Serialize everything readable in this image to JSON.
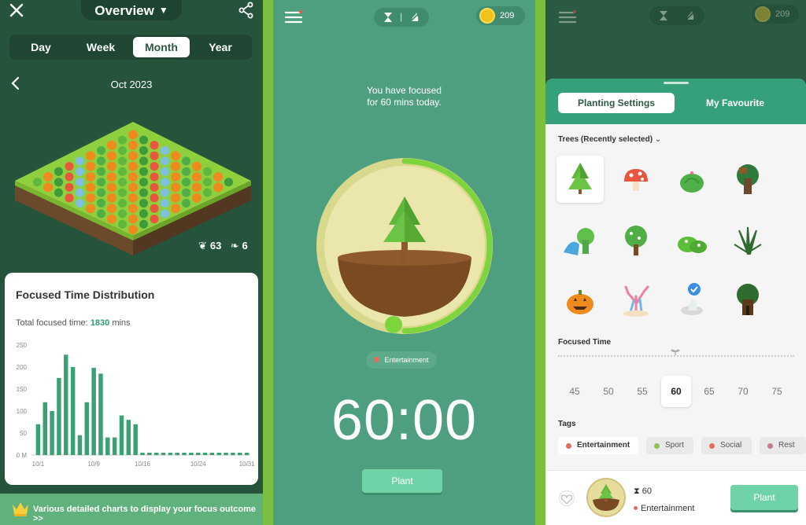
{
  "panel1": {
    "title": "Overview",
    "tabs": [
      {
        "label": "Day"
      },
      {
        "label": "Week"
      },
      {
        "label": "Month"
      },
      {
        "label": "Year"
      }
    ],
    "active_tab": "Month",
    "period": "Oct 2023",
    "healthy_count": "63",
    "dead_count": "6",
    "card_title": "Focused Time Distribution",
    "total_prefix": "Total focused time: ",
    "total_value": "1830",
    "total_unit": " mins",
    "banner": "Various detailed charts to display your focus outcome >>"
  },
  "chart_data": {
    "type": "bar",
    "categories": [
      "10/1",
      "10/2",
      "10/3",
      "10/4",
      "10/5",
      "10/6",
      "10/7",
      "10/8",
      "10/9",
      "10/10",
      "10/11",
      "10/12",
      "10/13",
      "10/14",
      "10/15",
      "10/16",
      "10/17",
      "10/18",
      "10/19",
      "10/20",
      "10/21",
      "10/22",
      "10/23",
      "10/24",
      "10/25",
      "10/26",
      "10/27",
      "10/28",
      "10/29",
      "10/30",
      "10/31"
    ],
    "values": [
      70,
      120,
      100,
      175,
      228,
      200,
      45,
      120,
      198,
      185,
      40,
      40,
      90,
      80,
      70,
      0,
      0,
      0,
      0,
      0,
      0,
      0,
      0,
      0,
      0,
      0,
      0,
      0,
      0,
      0,
      0
    ],
    "y_ticks": [
      "250",
      "200",
      "150",
      "100",
      "50",
      "0 M"
    ],
    "x_ticks": [
      "10/1",
      "10/9",
      "10/16",
      "10/24",
      "10/31"
    ],
    "ylim": [
      0,
      250
    ],
    "color": "#3aa272"
  },
  "panel2": {
    "coins": "209",
    "message_line1": "You have focused",
    "message_line2": "for 60 mins today.",
    "tag": "Entertainment",
    "timer": "60:00",
    "plant_label": "Plant",
    "progress": 0.5
  },
  "panel3": {
    "coins": "209",
    "tab_planting": "Planting Settings",
    "tab_favourite": "My Favourite",
    "trees_label": "Trees (Recently selected)",
    "focused_time_label": "Focused Time",
    "times": [
      "45",
      "50",
      "55",
      "60",
      "65",
      "70",
      "75"
    ],
    "selected_time": "60",
    "tags_label": "Tags",
    "tags": [
      {
        "label": "Entertainment",
        "color": "#e86a5a"
      },
      {
        "label": "Sport",
        "color": "#8bc34a"
      },
      {
        "label": "Social",
        "color": "#e86a5a"
      },
      {
        "label": "Rest",
        "color": "#c97a8a"
      }
    ],
    "summary_time": "60",
    "summary_tag": "Entertainment",
    "plant_label": "Plant"
  },
  "colors": {
    "accent": "#36a07b",
    "dark": "#25533c",
    "bar": "#3aa272",
    "coin": "#f2c21b"
  }
}
